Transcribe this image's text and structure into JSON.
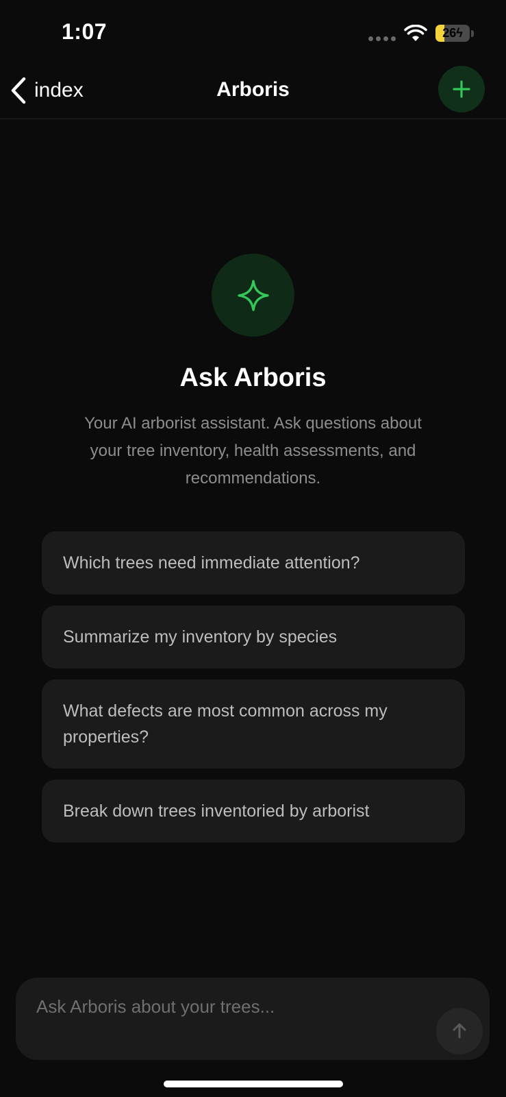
{
  "status_bar": {
    "time": "1:07",
    "battery_level": "26",
    "battery_fraction": 0.26,
    "battery_color": "#f5d33c",
    "icons": [
      "signal-dots-icon",
      "wifi-icon",
      "battery-icon",
      "charging-bolt-icon"
    ]
  },
  "nav": {
    "back_label": "index",
    "title": "Arboris",
    "back_icon": "chevron-left-icon",
    "action_icon": "plus-icon"
  },
  "hero": {
    "icon": "sparkle-icon",
    "title": "Ask Arboris",
    "subtitle": "Your AI arborist assistant. Ask questions about your tree inventory, health assessments, and recommendations."
  },
  "suggestions": [
    {
      "label": "Which trees need immediate attention?"
    },
    {
      "label": "Summarize my inventory by species"
    },
    {
      "label": "What defects are most common across my properties?"
    },
    {
      "label": "Break down trees inventoried by arborist"
    }
  ],
  "composer": {
    "placeholder": "Ask Arboris about your trees...",
    "value": "",
    "send_icon": "arrow-up-icon"
  },
  "colors": {
    "accent": "#34c759",
    "background": "#0b0b0b",
    "card": "#1b1b1b",
    "accent_bg": "#10301a"
  }
}
